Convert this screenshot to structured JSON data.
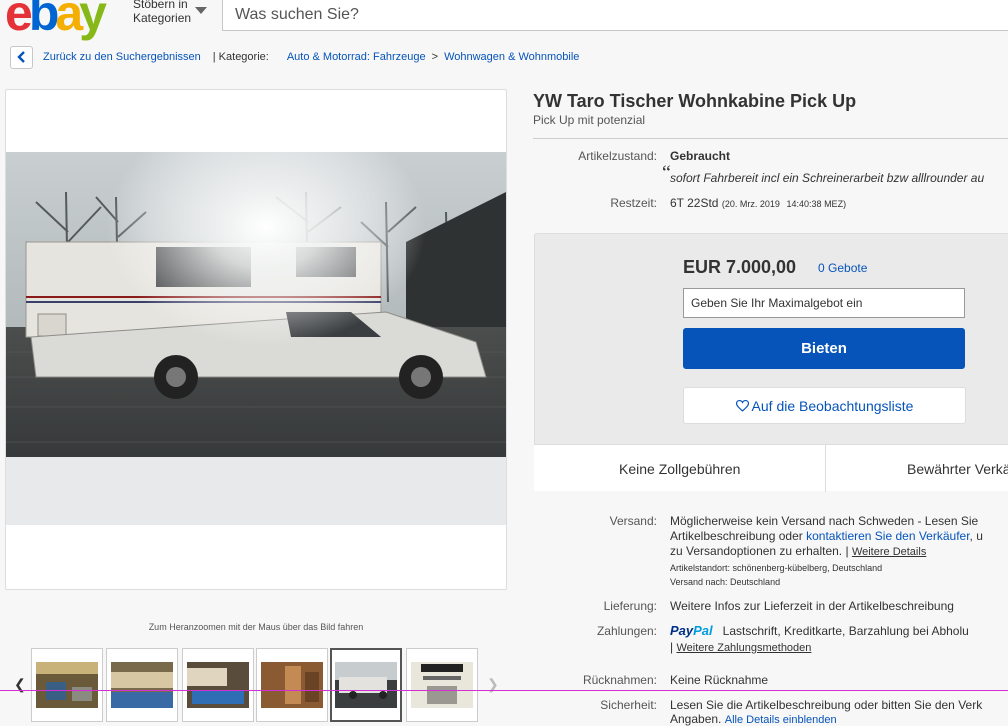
{
  "header": {
    "logo_letters": [
      "e",
      "b",
      "a",
      "y"
    ],
    "browse_line1": "Stöbern in",
    "browse_line2": "Kategorien",
    "search_placeholder": "Was suchen Sie?"
  },
  "breadcrumb": {
    "back_label": "Zurück zu den Suchergebnissen",
    "category_label": "| Kategorie:",
    "items": [
      "Auto & Motorrad: Fahrzeuge",
      "Wohnwagen & Wohnmobile"
    ],
    "separator": ">"
  },
  "gallery": {
    "zoom_hint": "Zum Heranzoomen mit der Maus über das Bild fahren",
    "thumbnail_count": 6,
    "selected_index": 4
  },
  "listing": {
    "title": "YW Taro Tischer Wohnkabine Pick Up",
    "subtitle": "Pick Up mit potenzial",
    "condition_label": "Artikelzustand:",
    "condition_value": "Gebraucht",
    "seller_note": "sofort Fahrbereit incl ein Schreinerarbeit bzw alllrounder au",
    "time_left_label": "Restzeit:",
    "time_left_value": "6T 22Std",
    "end_date": "(20. Mrz. 2019",
    "end_time": "14:40:38 MEZ)"
  },
  "bid": {
    "price": "EUR 7.000,00",
    "bids_count": "0 Gebote",
    "max_bid_placeholder": "Geben Sie Ihr Maximalgebot ein",
    "bid_button": "Bieten",
    "watch_button": "Auf die Beobachtungsliste",
    "strip_left": "Keine Zollgebühren",
    "strip_right": "Bewährter Verkä"
  },
  "shipping": {
    "label": "Versand:",
    "line1": "Möglicherweise kein Versand nach Schweden - Lesen Sie",
    "line2_pre": "Artikelbeschreibung oder",
    "line2_link": "kontaktieren Sie den Verkäufer",
    "line2_post": ", u",
    "line3_pre": "zu Versandoptionen zu erhalten.",
    "line3_link": "Weitere Details",
    "location": "Artikelstandort:  schönenberg-kübelberg, Deutschland",
    "ships_to": "Versand nach:  Deutschland"
  },
  "delivery": {
    "label": "Lieferung:",
    "value": "Weitere Infos zur Lieferzeit in der Artikelbeschreibung"
  },
  "payments": {
    "label": "Zahlungen:",
    "paypal_part1": "Pay",
    "paypal_part2": "Pal",
    "methods": "Lastschrift,  Kreditkarte,  Barzahlung bei Abholu",
    "more_link": "Weitere Zahlungsmethoden"
  },
  "returns": {
    "label": "Rücknahmen:",
    "value": "Keine Rücknahme"
  },
  "security": {
    "label": "Sicherheit:",
    "line1": "Lesen Sie die Artikelbeschreibung oder bitten Sie den Verk",
    "line2": "Angaben.",
    "link": "Alle Details einblenden"
  },
  "colors": {
    "ebay_red": "#e53238",
    "ebay_blue": "#0064d2",
    "ebay_yellow": "#f5af02",
    "ebay_green": "#86b817",
    "link_blue": "#0654ba",
    "bid_button_bg": "#0654ba"
  }
}
